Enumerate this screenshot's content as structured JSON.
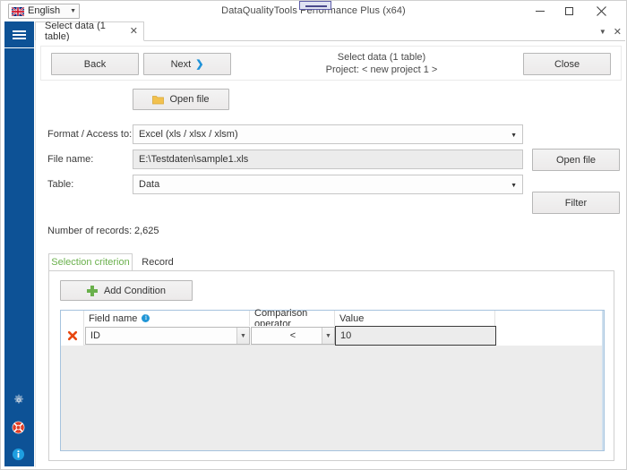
{
  "window": {
    "title": "DataQualityTools Performance Plus (x64)",
    "minimize_icon": "minimize-icon",
    "maximize_icon": "maximize-icon",
    "close_icon": "close-icon"
  },
  "language_selector": {
    "label": "English",
    "flag_icon": "union-jack-flag-icon",
    "caret_icon": "chevron-down-icon"
  },
  "sidebar": {
    "menu_icon": "hamburger-menu-icon",
    "accent_color": "#0d5296",
    "icons": [
      {
        "name": "gear-icon"
      },
      {
        "name": "lifebuoy-help-icon"
      },
      {
        "name": "info-icon"
      }
    ]
  },
  "tabstrip": {
    "tabs": [
      {
        "label": "Select data (1 table)",
        "close_icon": "close-icon",
        "active": true
      }
    ],
    "list_caret_icon": "chevron-down-icon",
    "close_all_icon": "close-icon"
  },
  "toolbar": {
    "back_label": "Back",
    "next_label": "Next",
    "next_caret_icon": "chevron-right-icon",
    "close_label": "Close",
    "heading": "Select data (1 table)",
    "subheading": "Project: < new project 1 >"
  },
  "form": {
    "open_file_top_label": "Open file",
    "folder_icon": "folder-icon",
    "folder_color": "#f2c14e",
    "fields": [
      {
        "label": "Format / Access to:",
        "value": "Excel (xls / xlsx / xlsm)",
        "type": "combo",
        "caret_icon": "chevron-down-icon"
      },
      {
        "label": "File name:",
        "value": "E:\\Testdaten\\sample1.xls",
        "type": "text"
      },
      {
        "label": "Table:",
        "value": "Data",
        "type": "combo",
        "caret_icon": "chevron-down-icon"
      }
    ],
    "open_file_side_label": "Open file",
    "filter_label": "Filter",
    "records_label": "Number of records:",
    "records_value": "2,625"
  },
  "inner_tabs": {
    "items": [
      {
        "label": "Selection criterion",
        "active": true
      },
      {
        "label": "Record",
        "active": false
      }
    ],
    "active_color": "#6ab04c"
  },
  "condition_panel": {
    "add_condition_label": "Add Condition",
    "plus_icon": "plus-icon",
    "plus_color": "#6ab04c",
    "grid": {
      "columns": [
        {
          "header": "",
          "name": "delete-column"
        },
        {
          "header": "Field name",
          "name": "field-name-column",
          "info_icon": "info-icon"
        },
        {
          "header": "Comparison operator",
          "name": "comparison-operator-column"
        },
        {
          "header": "Value",
          "name": "value-column"
        },
        {
          "header": "",
          "name": "spacer-column"
        }
      ],
      "rows": [
        {
          "delete_icon": "delete-x-icon",
          "delete_color": "#e8470f",
          "field_name": "ID",
          "comparison_operator": "<",
          "value": "10"
        }
      ]
    }
  }
}
